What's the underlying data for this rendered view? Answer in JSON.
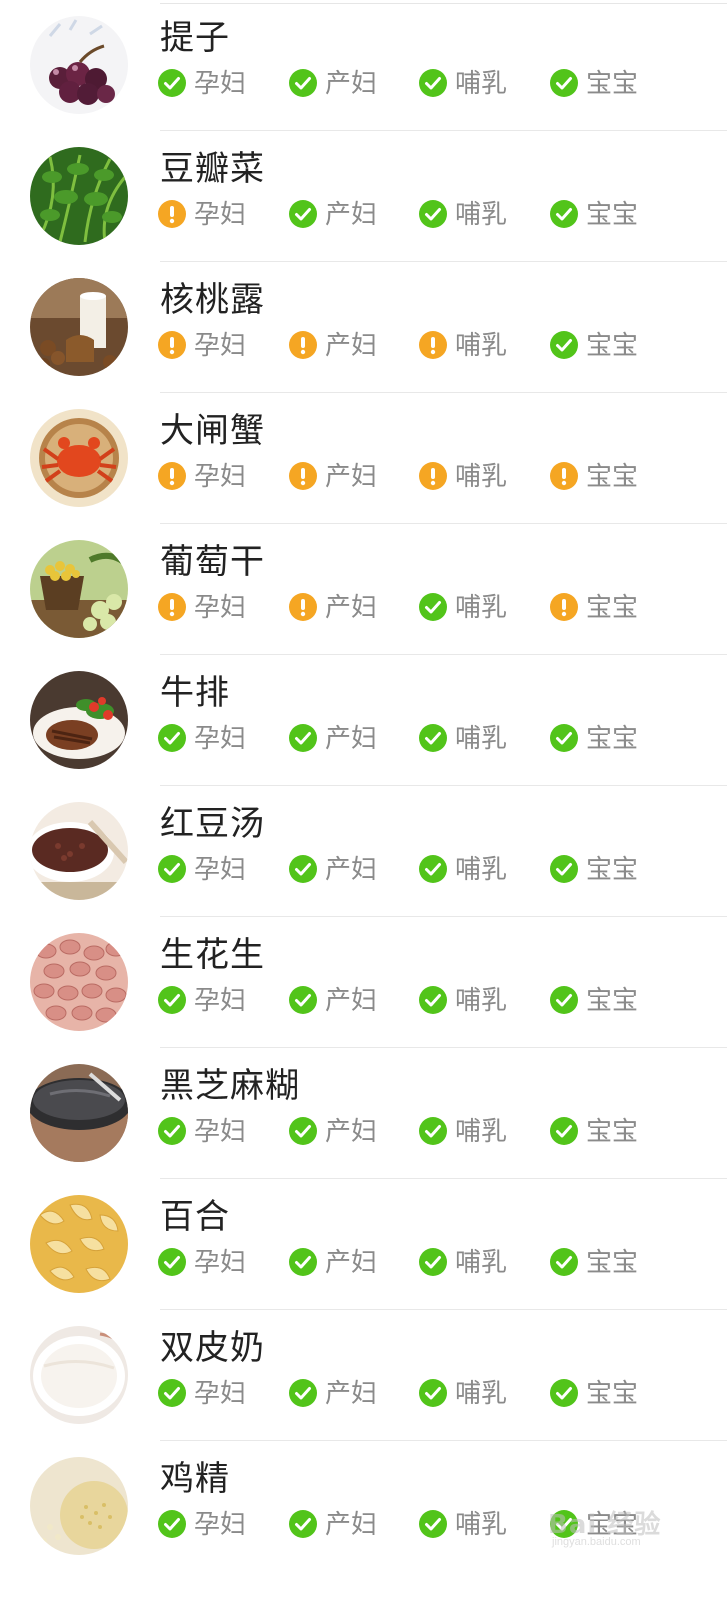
{
  "colors": {
    "ok": "#52c41a",
    "warn": "#f5a623",
    "text_primary": "#222222",
    "text_secondary": "#8a8a8a",
    "divider": "#e8e8e8"
  },
  "tag_labels": [
    "孕妇",
    "产妇",
    "哺乳",
    "宝宝"
  ],
  "foods": [
    {
      "name": "提子",
      "image": "grapes-photo",
      "status": [
        "ok",
        "ok",
        "ok",
        "ok"
      ],
      "labels": [
        "孕妇",
        "产妇",
        "哺乳",
        "宝宝"
      ]
    },
    {
      "name": "豆瓣菜",
      "image": "watercress-photo",
      "status": [
        "warn",
        "ok",
        "ok",
        "ok"
      ],
      "labels": [
        "孕妇",
        "产妇",
        "哺乳",
        "宝宝"
      ]
    },
    {
      "name": "核桃露",
      "image": "walnut-milk-photo",
      "status": [
        "warn",
        "warn",
        "warn",
        "ok"
      ],
      "labels": [
        "孕妇",
        "产妇",
        "哺乳",
        "宝宝"
      ]
    },
    {
      "name": "大闸蟹",
      "image": "hairy-crab-photo",
      "status": [
        "warn",
        "warn",
        "warn",
        "warn"
      ],
      "labels": [
        "孕妇",
        "产妇",
        "哺乳",
        "宝宝"
      ]
    },
    {
      "name": "葡萄干",
      "image": "raisins-photo",
      "status": [
        "warn",
        "warn",
        "ok",
        "warn"
      ],
      "labels": [
        "孕妇",
        "产妇",
        "哺乳",
        "宝宝"
      ]
    },
    {
      "name": "牛排",
      "image": "steak-photo",
      "status": [
        "ok",
        "ok",
        "ok",
        "ok"
      ],
      "labels": [
        "孕妇",
        "产妇",
        "哺乳",
        "宝宝"
      ]
    },
    {
      "name": "红豆汤",
      "image": "red-bean-soup-photo",
      "status": [
        "ok",
        "ok",
        "ok",
        "ok"
      ],
      "labels": [
        "孕妇",
        "产妇",
        "哺乳",
        "宝宝"
      ]
    },
    {
      "name": "生花生",
      "image": "raw-peanuts-photo",
      "status": [
        "ok",
        "ok",
        "ok",
        "ok"
      ],
      "labels": [
        "孕妇",
        "产妇",
        "哺乳",
        "宝宝"
      ]
    },
    {
      "name": "黑芝麻糊",
      "image": "black-sesame-paste-photo",
      "status": [
        "ok",
        "ok",
        "ok",
        "ok"
      ],
      "labels": [
        "孕妇",
        "产妇",
        "哺乳",
        "宝宝"
      ]
    },
    {
      "name": "百合",
      "image": "lily-bulb-photo",
      "status": [
        "ok",
        "ok",
        "ok",
        "ok"
      ],
      "labels": [
        "孕妇",
        "产妇",
        "哺乳",
        "宝宝"
      ]
    },
    {
      "name": "双皮奶",
      "image": "double-skin-milk-photo",
      "status": [
        "ok",
        "ok",
        "ok",
        "ok"
      ],
      "labels": [
        "孕妇",
        "产妇",
        "哺乳",
        "宝宝"
      ]
    },
    {
      "name": "鸡精",
      "image": "chicken-essence-photo",
      "status": [
        "ok",
        "ok",
        "ok",
        "ok"
      ],
      "labels": [
        "孕妇",
        "产妇",
        "哺乳",
        "宝宝"
      ]
    }
  ],
  "watermark": {
    "text": "Bai 经验",
    "subtext": "jingyan.baidu.com"
  }
}
